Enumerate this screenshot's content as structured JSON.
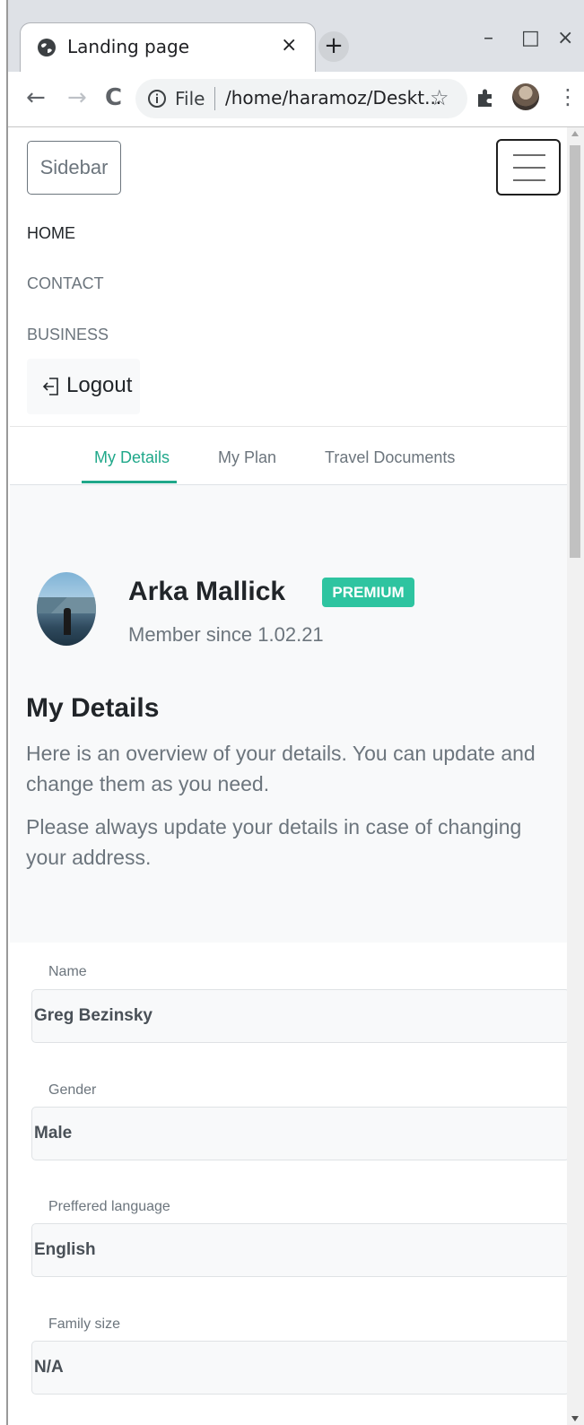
{
  "browser": {
    "tab_title": "Landing page",
    "tab_close": "×",
    "new_tab": "+",
    "window_minimize": "–",
    "window_maximize": "□",
    "window_close": "×",
    "back": "←",
    "forward": "→",
    "reload": "C",
    "omnibox_scheme": "File",
    "omnibox_url": "/home/haramoz/Deskt...",
    "bookmark_star": "☆",
    "menu": "⋮",
    "icons": [
      "globe-icon",
      "info-icon",
      "puzzle-icon",
      "avatar",
      "star-icon",
      "kebab-menu-icon"
    ]
  },
  "navbar": {
    "sidebar_button": "Sidebar",
    "links": [
      {
        "label": "HOME",
        "active": true
      },
      {
        "label": "CONTACT",
        "active": false
      },
      {
        "label": "BUSINESS",
        "active": false
      }
    ],
    "logout_label": "Logout"
  },
  "tabs": [
    {
      "label": "My Details",
      "active": true
    },
    {
      "label": "My Plan",
      "active": false
    },
    {
      "label": "Travel Documents",
      "active": false
    }
  ],
  "profile": {
    "name": "Arka Mallick",
    "badge": "PREMIUM",
    "member_since": "Member since 1.02.21"
  },
  "details": {
    "title": "My Details",
    "paragraph_1": "Here is an overview of your details. You can update and change them as you need.",
    "paragraph_2": "Please always update your details in case of changing your address."
  },
  "fields": [
    {
      "label": "Name",
      "value": "Greg Bezinsky"
    },
    {
      "label": "Gender",
      "value": "Male"
    },
    {
      "label": "Preffered language",
      "value": "English"
    },
    {
      "label": "Family size",
      "value": "N/A"
    }
  ],
  "colors": {
    "accent": "#20a88a",
    "badge": "#2ec4a0",
    "muted_text": "#6c757d"
  }
}
